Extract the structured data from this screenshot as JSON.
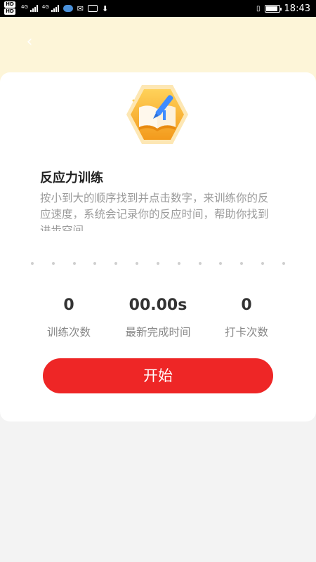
{
  "status_bar": {
    "hd_badges": [
      "HD",
      "HD"
    ],
    "network_labels": [
      "4G",
      "4G"
    ],
    "time": "18:43"
  },
  "header": {
    "back_icon": "chevron-left-icon"
  },
  "card": {
    "icon": "book-pencil-icon",
    "title": "反应力训练",
    "description": "按小到大的顺序找到并点击数字，来训练你的反应速度，系统会记录你的反应时间，帮助你找到进步空间。",
    "stats": [
      {
        "value": "0",
        "label": "训练次数"
      },
      {
        "value": "00.00s",
        "label": "最新完成时间"
      },
      {
        "value": "0",
        "label": "打卡次数"
      }
    ],
    "start_label": "开始"
  },
  "colors": {
    "header_bg": "#fdf5d8",
    "accent_red": "#ee2626",
    "icon_orange": "#f6a623",
    "icon_blue": "#3f8cff"
  }
}
